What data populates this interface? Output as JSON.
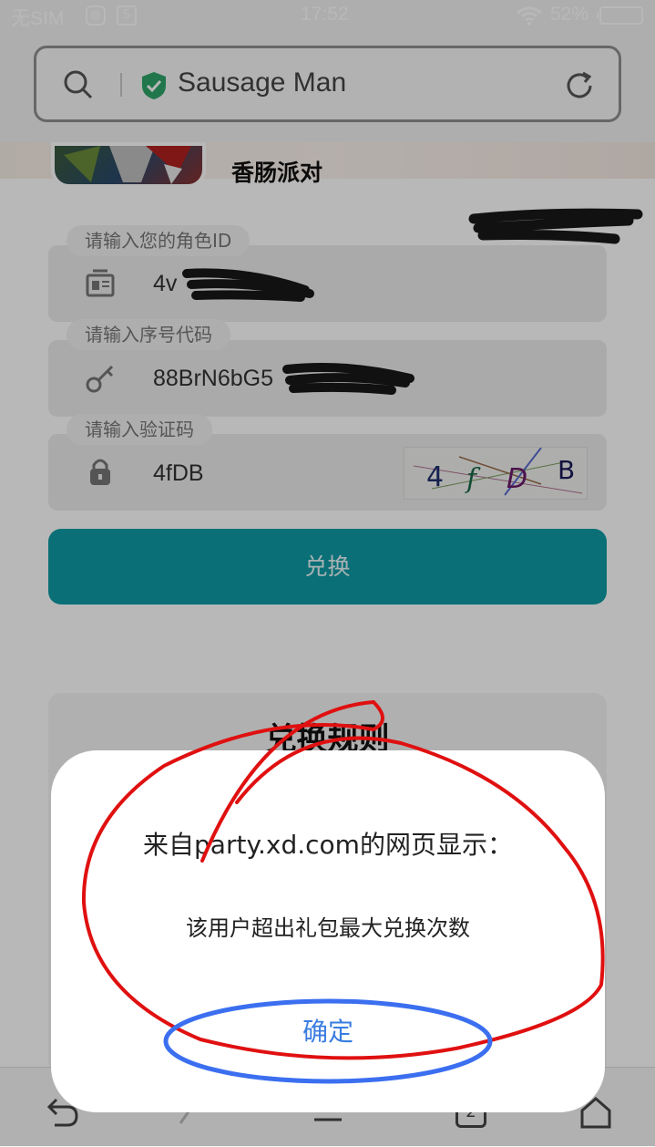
{
  "status_bar": {
    "carrier": "无SIM",
    "time": "17:52",
    "battery": "52%"
  },
  "browser": {
    "address_text": "Sausage Man",
    "icons": [
      "search-icon",
      "shield-check-icon",
      "refresh-icon"
    ]
  },
  "game": {
    "name": "香肠派对"
  },
  "form": {
    "role_id": {
      "label": "请输入您的角色ID",
      "value": "4v"
    },
    "code": {
      "label": "请输入序号代码",
      "value": "88BrN6bG5"
    },
    "captcha": {
      "label": "请输入验证码",
      "value": "4fDB",
      "image_chars": [
        "4",
        "f",
        "D",
        "B"
      ]
    },
    "submit_label": "兑换"
  },
  "rules": {
    "title": "兑换规则"
  },
  "dialog": {
    "title": "来自party.xd.com的网页显示：",
    "message": "该用户超出礼包最大兑换次数",
    "ok_label": "确定"
  },
  "toolbar": {
    "tab_count": "2",
    "icons": [
      "back-icon",
      "forward-icon",
      "menu-icon",
      "tabs-icon",
      "home-icon"
    ]
  },
  "colors": {
    "accent": "#0e9aa5",
    "dialog_button": "#3a7de0",
    "annotation_red": "#e01010",
    "annotation_blue": "#3b6ff0"
  }
}
